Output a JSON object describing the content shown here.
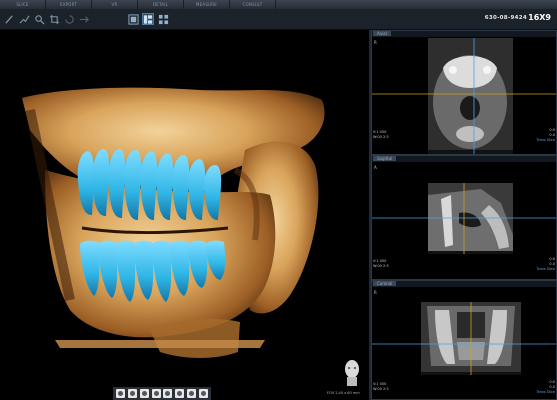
{
  "menubar": {
    "tabs": [
      "SLICE",
      "EXPORT",
      "VR",
      "DETAIL",
      "MEASURE",
      "CONSULT"
    ]
  },
  "toolbar": {
    "tools": [
      "pointer-tool",
      "measure-line-tool",
      "zoom-tool",
      "crop-tool",
      "rotate-tool",
      "arrow-tool",
      "layout-1-tool",
      "layout-2-tool",
      "layout-3-tool"
    ]
  },
  "patient": {
    "id": "630-08-9424",
    "number": "16X9"
  },
  "view3d": {
    "fov_text": "FOV 2.40 x 60 mm"
  },
  "panels": {
    "axial": {
      "label": "Axial",
      "orient_top": "R",
      "info_left_1": "V:1 000",
      "info_left_2": "W:00 2:3",
      "info_right_1": "0:0",
      "info_right_2": "0.0",
      "info_right_3": "Trans Slice"
    },
    "sagittal": {
      "label": "Sagittal",
      "orient_top": "A",
      "info_left_1": "V:1 000",
      "info_left_2": "W:00 2:3",
      "info_right_1": "0:0",
      "info_right_2": "0.0",
      "info_right_3": "Trans Slice"
    },
    "coronal": {
      "label": "Coronal",
      "orient_top": "R",
      "info_left_1": "V:1 000",
      "info_left_2": "W:00 2:3",
      "info_right_1": "0:0",
      "info_right_2": "0.0",
      "info_right_3": "Trans Slice"
    }
  },
  "colors": {
    "crosshair_horizontal": "#c9a227",
    "crosshair_vertical": "#4aa3e8",
    "teeth": "#2fb6e6",
    "bone": "#d9a45c"
  }
}
